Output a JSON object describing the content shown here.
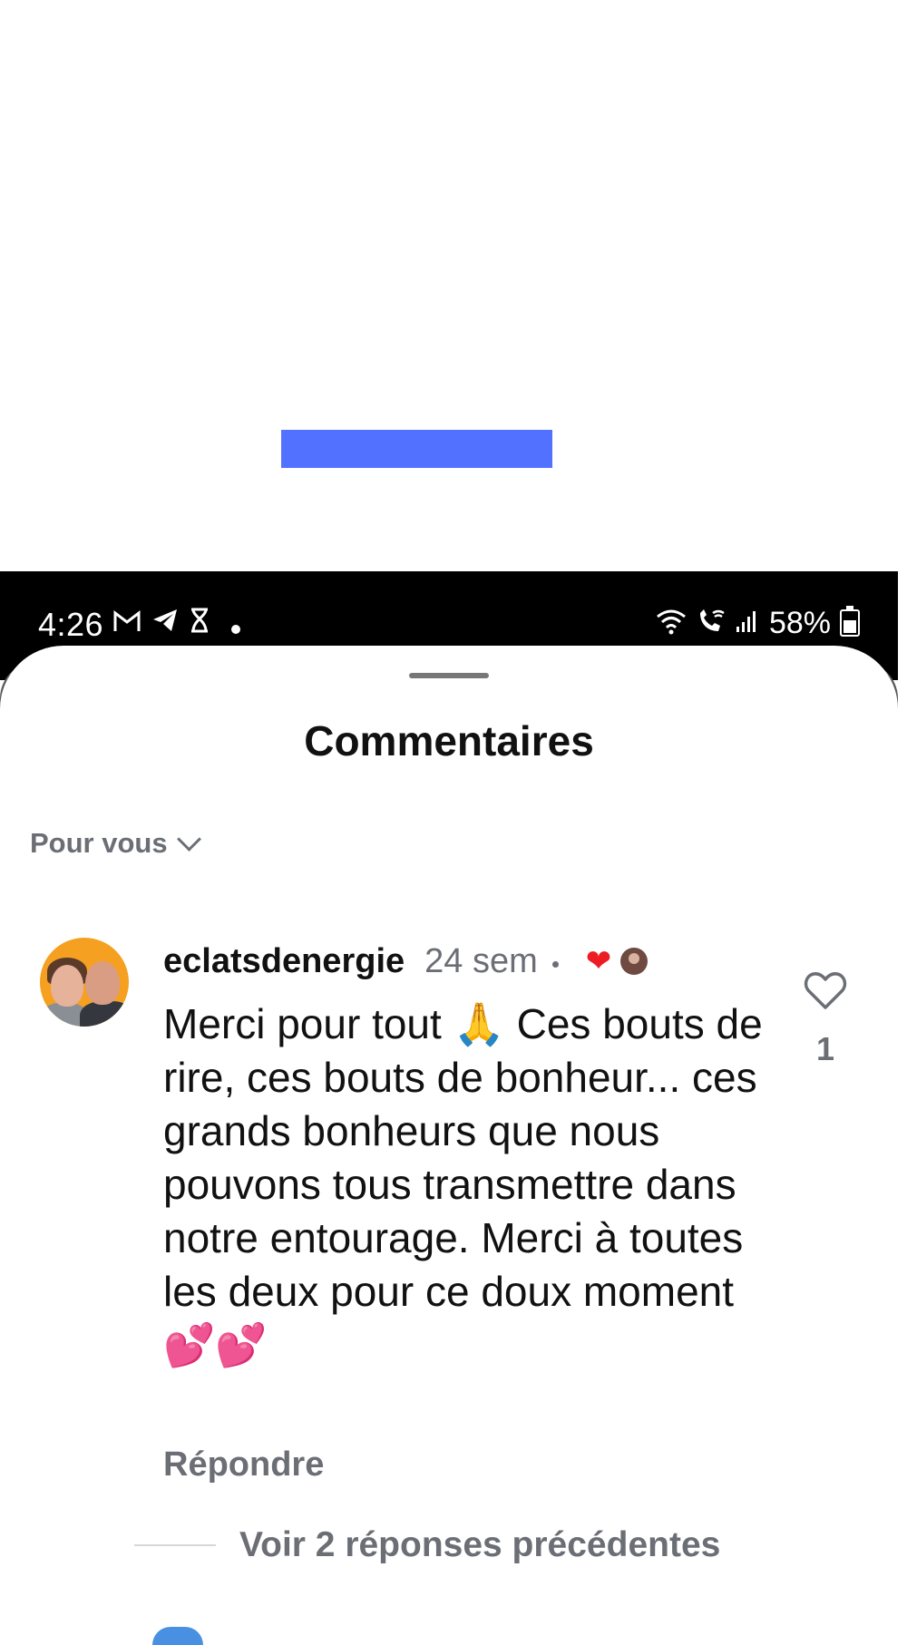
{
  "status_bar": {
    "time": "4:26",
    "battery": "58%",
    "left_icons": [
      "gmail-icon",
      "telegram-icon",
      "hourglass-icon",
      "dot-icon"
    ],
    "right_icons": [
      "wifi-icon",
      "wifi-call-icon",
      "signal-icon",
      "battery-icon"
    ]
  },
  "sheet": {
    "title": "Commentaires"
  },
  "sort": {
    "label": "Pour vous"
  },
  "comment": {
    "username": "eclatsdenergie",
    "age": "24 sem",
    "text": "Merci pour tout 🙏 Ces bouts de rire, ces bouts de bonheur... ces grands bonheurs que nous pouvons tous transmettre dans notre entourage. Merci à toutes les deux pour ce doux moment 💕💕",
    "reply_label": "Répondre",
    "like_count": "1"
  },
  "view_replies": {
    "label": "Voir 2 réponses précédentes"
  },
  "colors": {
    "accent_blue": "#5271ff",
    "heart_red": "#ed1c24",
    "muted_text": "#6b6f75",
    "avatar_bg": "#f5a020"
  }
}
